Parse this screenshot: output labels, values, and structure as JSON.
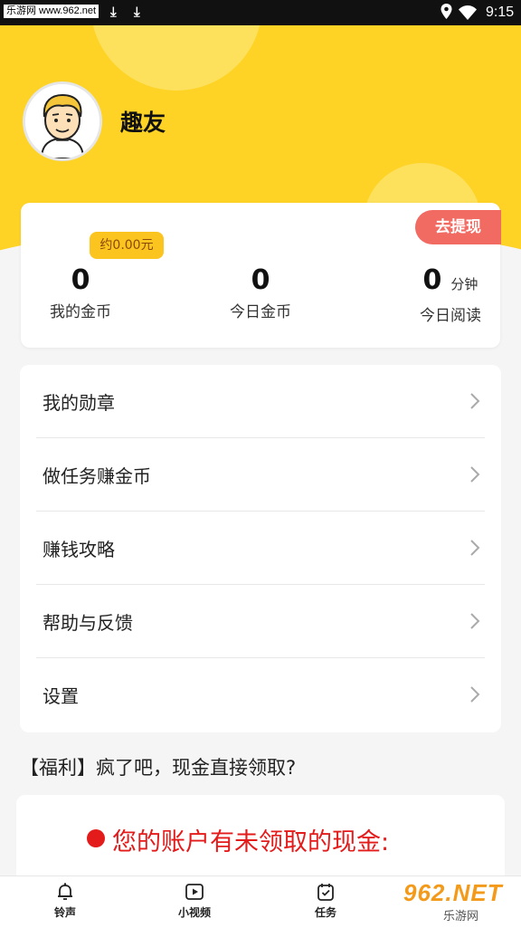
{
  "status_bar": {
    "watermark": "乐游网 www.962.net",
    "time": "9:15"
  },
  "profile": {
    "name": "趣友"
  },
  "stats": {
    "withdraw_label": "去提现",
    "approx_label": "约0.00元",
    "my_coins": {
      "value": "0",
      "label": "我的金币"
    },
    "today_coins": {
      "value": "0",
      "label": "今日金币"
    },
    "today_reading": {
      "value": "0",
      "unit": "分钟",
      "label": "今日阅读"
    }
  },
  "menu": {
    "items": [
      {
        "label": "我的勋章"
      },
      {
        "label": "做任务赚金币"
      },
      {
        "label": "赚钱攻略"
      },
      {
        "label": "帮助与反馈"
      },
      {
        "label": "设置"
      }
    ]
  },
  "promo": {
    "text": "【福利】疯了吧，现金直接领取?"
  },
  "cash_card": {
    "text": "您的账户有未领取的现金:"
  },
  "bottom_nav": {
    "items": [
      {
        "label": "铃声",
        "icon": "bell-icon"
      },
      {
        "label": "小视频",
        "icon": "play-icon"
      },
      {
        "label": "任务",
        "icon": "task-icon"
      }
    ]
  },
  "watermark_logo": {
    "big": "962.NET",
    "small": "乐游网"
  },
  "colors": {
    "header_yellow": "#fed325",
    "withdraw_red": "#f26b63",
    "approx_badge": "#fcc41e",
    "cash_red": "#e41b1b"
  }
}
